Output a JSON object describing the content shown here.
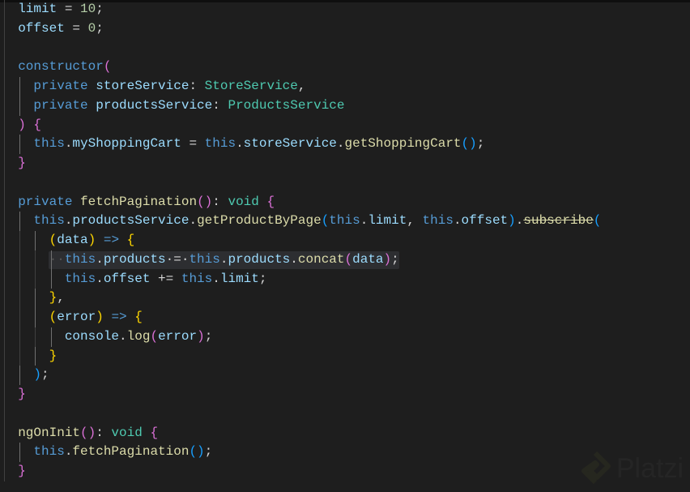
{
  "editor": {
    "lines": [
      {
        "indent": 1,
        "tokens": [
          {
            "t": "  "
          },
          {
            "t": "limit",
            "c": "v"
          },
          {
            "t": " = ",
            "c": "o"
          },
          {
            "t": "10",
            "c": "n"
          },
          {
            "t": ";",
            "c": "o"
          }
        ]
      },
      {
        "indent": 1,
        "tokens": [
          {
            "t": "  "
          },
          {
            "t": "offset",
            "c": "v"
          },
          {
            "t": " = ",
            "c": "o"
          },
          {
            "t": "0",
            "c": "n"
          },
          {
            "t": ";",
            "c": "o"
          }
        ]
      },
      {
        "indent": 1,
        "tokens": []
      },
      {
        "indent": 1,
        "tokens": [
          {
            "t": "  "
          },
          {
            "t": "constructor",
            "c": "k"
          },
          {
            "t": "(",
            "c": "b2"
          }
        ]
      },
      {
        "indent": 2,
        "tokens": [
          {
            "t": "    "
          },
          {
            "t": "private",
            "c": "k"
          },
          {
            "t": " "
          },
          {
            "t": "storeService",
            "c": "v"
          },
          {
            "t": ": ",
            "c": "o"
          },
          {
            "t": "StoreService",
            "c": "t"
          },
          {
            "t": ",",
            "c": "o"
          }
        ]
      },
      {
        "indent": 2,
        "tokens": [
          {
            "t": "    "
          },
          {
            "t": "private",
            "c": "k"
          },
          {
            "t": " "
          },
          {
            "t": "productsService",
            "c": "v"
          },
          {
            "t": ": ",
            "c": "o"
          },
          {
            "t": "ProductsService",
            "c": "t"
          }
        ]
      },
      {
        "indent": 1,
        "tokens": [
          {
            "t": "  "
          },
          {
            "t": ")",
            "c": "b2"
          },
          {
            "t": " "
          },
          {
            "t": "{",
            "c": "b2"
          }
        ]
      },
      {
        "indent": 2,
        "tokens": [
          {
            "t": "    "
          },
          {
            "t": "this",
            "c": "k"
          },
          {
            "t": ".",
            "c": "o"
          },
          {
            "t": "myShoppingCart",
            "c": "v"
          },
          {
            "t": " = ",
            "c": "o"
          },
          {
            "t": "this",
            "c": "k"
          },
          {
            "t": ".",
            "c": "o"
          },
          {
            "t": "storeService",
            "c": "v"
          },
          {
            "t": ".",
            "c": "o"
          },
          {
            "t": "getShoppingCart",
            "c": "f"
          },
          {
            "t": "()",
            "c": "b3"
          },
          {
            "t": ";",
            "c": "o"
          }
        ]
      },
      {
        "indent": 1,
        "tokens": [
          {
            "t": "  "
          },
          {
            "t": "}",
            "c": "b2"
          }
        ]
      },
      {
        "indent": 1,
        "tokens": []
      },
      {
        "indent": 1,
        "tokens": [
          {
            "t": "  "
          },
          {
            "t": "private",
            "c": "k"
          },
          {
            "t": " "
          },
          {
            "t": "fetchPagination",
            "c": "f"
          },
          {
            "t": "()",
            "c": "b2"
          },
          {
            "t": ": ",
            "c": "o"
          },
          {
            "t": "void",
            "c": "t"
          },
          {
            "t": " "
          },
          {
            "t": "{",
            "c": "b2"
          }
        ]
      },
      {
        "indent": 2,
        "tokens": [
          {
            "t": "    "
          },
          {
            "t": "this",
            "c": "k"
          },
          {
            "t": ".",
            "c": "o"
          },
          {
            "t": "productsService",
            "c": "v"
          },
          {
            "t": ".",
            "c": "o"
          },
          {
            "t": "getProductByPage",
            "c": "f"
          },
          {
            "t": "(",
            "c": "b3"
          },
          {
            "t": "this",
            "c": "k"
          },
          {
            "t": ".",
            "c": "o"
          },
          {
            "t": "limit",
            "c": "v"
          },
          {
            "t": ", ",
            "c": "o"
          },
          {
            "t": "this",
            "c": "k"
          },
          {
            "t": ".",
            "c": "o"
          },
          {
            "t": "offset",
            "c": "v"
          },
          {
            "t": ")",
            "c": "b3"
          },
          {
            "t": ".",
            "c": "o"
          },
          {
            "t": "subscribe",
            "c": "s"
          },
          {
            "t": "(",
            "c": "b3"
          }
        ]
      },
      {
        "indent": 3,
        "tokens": [
          {
            "t": "      "
          },
          {
            "t": "(",
            "c": "b1"
          },
          {
            "t": "data",
            "c": "v"
          },
          {
            "t": ")",
            "c": "b1"
          },
          {
            "t": " => ",
            "c": "k"
          },
          {
            "t": "{",
            "c": "b1"
          }
        ]
      },
      {
        "indent": 4,
        "highlight": true,
        "tokens": [
          {
            "t": "  ",
            "c": "ws"
          },
          {
            "t": "  ",
            "c": "ws"
          },
          {
            "t": "  ",
            "c": "ws"
          },
          {
            "t": "··",
            "c": "ws"
          },
          {
            "t": "this",
            "c": "k"
          },
          {
            "t": ".",
            "c": "o"
          },
          {
            "t": "products",
            "c": "v"
          },
          {
            "t": "·=·",
            "c": "o"
          },
          {
            "t": "this",
            "c": "k"
          },
          {
            "t": ".",
            "c": "o"
          },
          {
            "t": "products",
            "c": "v"
          },
          {
            "t": ".",
            "c": "o"
          },
          {
            "t": "concat",
            "c": "f"
          },
          {
            "t": "(",
            "c": "b2"
          },
          {
            "t": "data",
            "c": "v"
          },
          {
            "t": ")",
            "c": "b2"
          },
          {
            "t": ";",
            "c": "o"
          }
        ]
      },
      {
        "indent": 4,
        "tokens": [
          {
            "t": "        "
          },
          {
            "t": "this",
            "c": "k"
          },
          {
            "t": ".",
            "c": "o"
          },
          {
            "t": "offset",
            "c": "v"
          },
          {
            "t": " += ",
            "c": "o"
          },
          {
            "t": "this",
            "c": "k"
          },
          {
            "t": ".",
            "c": "o"
          },
          {
            "t": "limit",
            "c": "v"
          },
          {
            "t": ";",
            "c": "o"
          }
        ]
      },
      {
        "indent": 3,
        "tokens": [
          {
            "t": "      "
          },
          {
            "t": "}",
            "c": "b1"
          },
          {
            "t": ",",
            "c": "o"
          }
        ]
      },
      {
        "indent": 3,
        "tokens": [
          {
            "t": "      "
          },
          {
            "t": "(",
            "c": "b1"
          },
          {
            "t": "error",
            "c": "v"
          },
          {
            "t": ")",
            "c": "b1"
          },
          {
            "t": " => ",
            "c": "k"
          },
          {
            "t": "{",
            "c": "b1"
          }
        ]
      },
      {
        "indent": 4,
        "tokens": [
          {
            "t": "        "
          },
          {
            "t": "console",
            "c": "v"
          },
          {
            "t": ".",
            "c": "o"
          },
          {
            "t": "log",
            "c": "f"
          },
          {
            "t": "(",
            "c": "b2"
          },
          {
            "t": "error",
            "c": "v"
          },
          {
            "t": ")",
            "c": "b2"
          },
          {
            "t": ";",
            "c": "o"
          }
        ]
      },
      {
        "indent": 3,
        "tokens": [
          {
            "t": "      "
          },
          {
            "t": "}",
            "c": "b1"
          }
        ]
      },
      {
        "indent": 2,
        "tokens": [
          {
            "t": "    "
          },
          {
            "t": ")",
            "c": "b3"
          },
          {
            "t": ";",
            "c": "o"
          }
        ]
      },
      {
        "indent": 1,
        "tokens": [
          {
            "t": "  "
          },
          {
            "t": "}",
            "c": "b2"
          }
        ]
      },
      {
        "indent": 1,
        "tokens": []
      },
      {
        "indent": 1,
        "tokens": [
          {
            "t": "  "
          },
          {
            "t": "ngOnInit",
            "c": "f"
          },
          {
            "t": "()",
            "c": "b2"
          },
          {
            "t": ": ",
            "c": "o"
          },
          {
            "t": "void",
            "c": "t"
          },
          {
            "t": " "
          },
          {
            "t": "{",
            "c": "b2"
          }
        ]
      },
      {
        "indent": 2,
        "tokens": [
          {
            "t": "    "
          },
          {
            "t": "this",
            "c": "k"
          },
          {
            "t": ".",
            "c": "o"
          },
          {
            "t": "fetchPagination",
            "c": "f"
          },
          {
            "t": "()",
            "c": "b3"
          },
          {
            "t": ";",
            "c": "o"
          }
        ]
      },
      {
        "indent": 1,
        "tokens": [
          {
            "t": "  "
          },
          {
            "t": "}",
            "c": "b2"
          }
        ]
      }
    ]
  },
  "watermark": {
    "text": "Platzi",
    "icon": "platzi-logo-icon"
  }
}
